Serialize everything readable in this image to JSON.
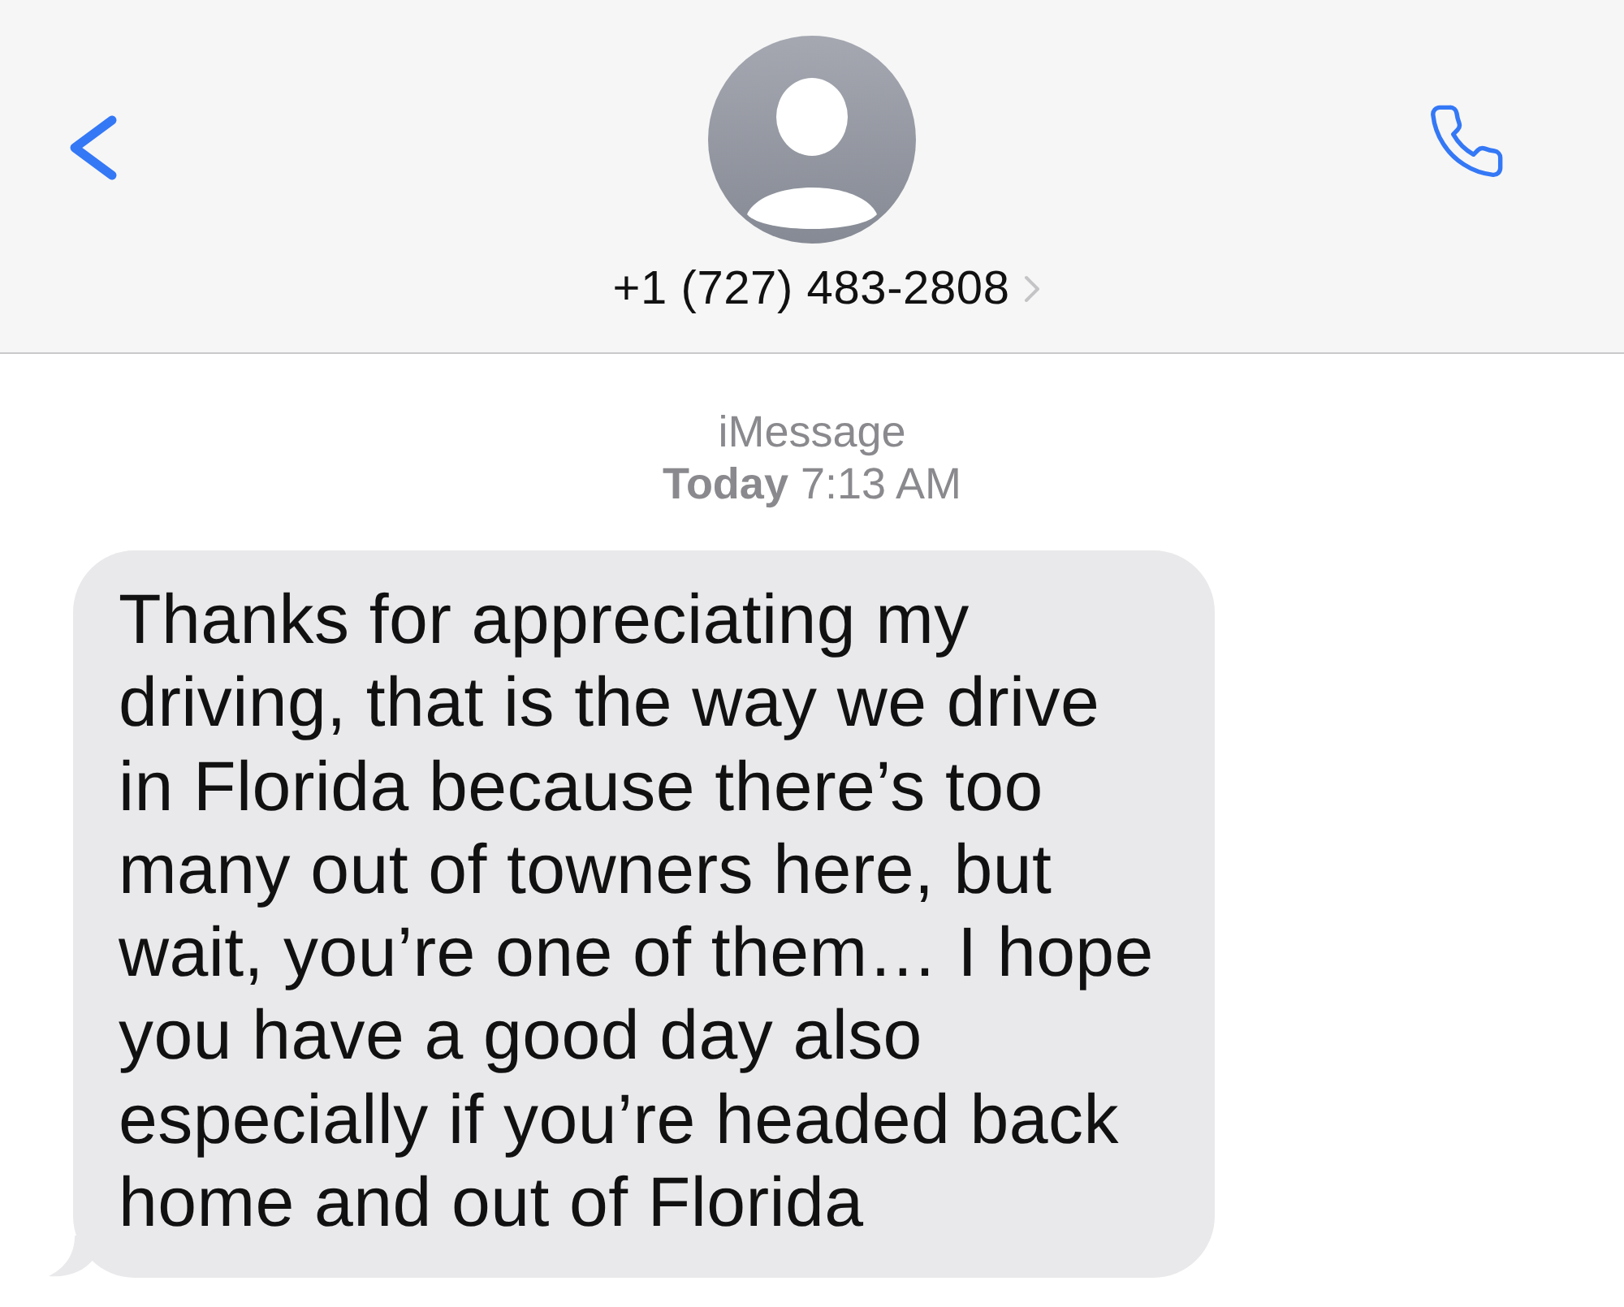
{
  "header": {
    "contact": "+1 (727) 483-2808"
  },
  "conversation": {
    "service": "iMessage",
    "timestamp": "**Today** 7:13 AM",
    "messages": [
      {
        "kind": "incoming",
        "text": "Thanks for appreciating my driving, that is the way we drive in Florida because there’s too many out of towners here, but wait, you’re one of them… I hope you have a good day also especially if you’re headed back home and out of Florida"
      }
    ]
  }
}
